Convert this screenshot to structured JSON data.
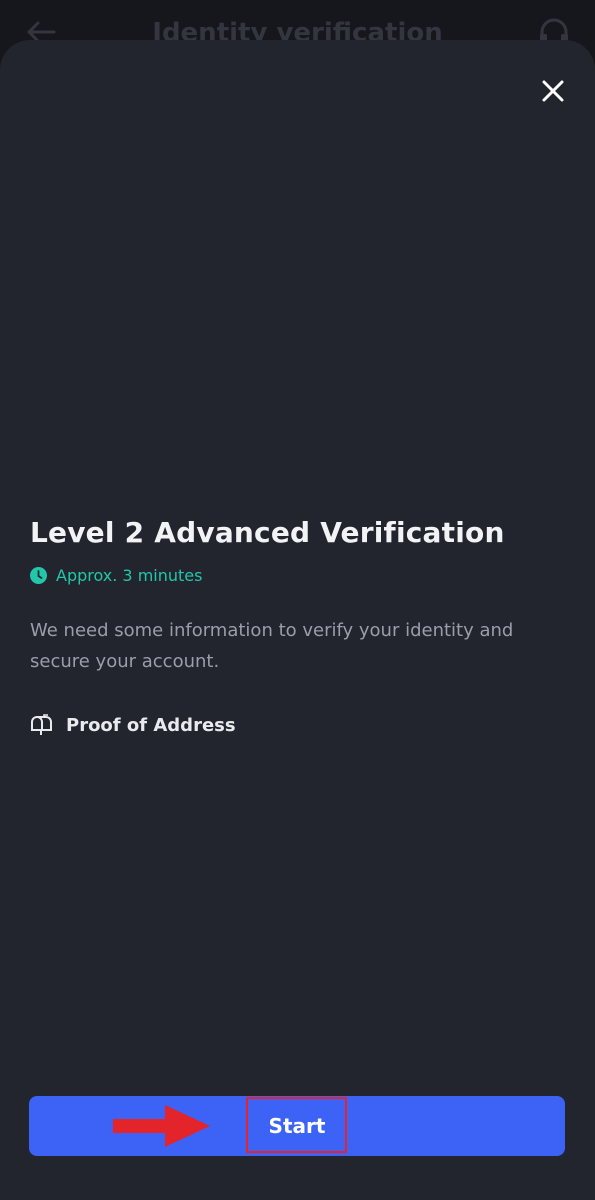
{
  "header": {
    "title": "Identity verification",
    "back_icon": "arrow-left-icon",
    "support_icon": "headset-icon"
  },
  "sheet": {
    "close_icon": "close-icon",
    "title": "Level 2 Advanced Verification",
    "time_estimate": "Approx. 3 minutes",
    "time_icon": "clock-icon",
    "description": "We need some information to verify your identity and secure your account.",
    "requirements": [
      {
        "icon": "mailbox-icon",
        "label": "Proof of Address"
      }
    ],
    "start_label": "Start"
  },
  "annotation": {
    "arrow_icon": "red-arrow-icon",
    "highlight_color": "#e3242b"
  },
  "colors": {
    "background": "#15171c",
    "sheet": "#22252e",
    "accent_green": "#22c7a9",
    "primary_button": "#3c63f6"
  }
}
